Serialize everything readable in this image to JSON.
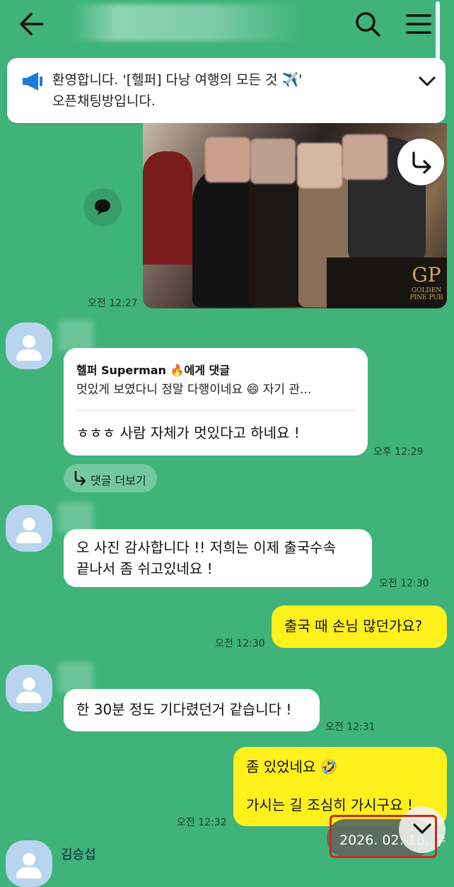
{
  "header": {
    "icons": [
      "back-arrow-icon",
      "search-icon",
      "menu-icon"
    ]
  },
  "notice": {
    "text": "환영합니다. '[헬퍼] 다낭 여행의 모든 것 ✈️'\n오픈채팅방입니다.",
    "icon": "megaphone-icon"
  },
  "photo": {
    "time": "오전 12:27",
    "logo_mark": "GP",
    "logo_text": "GOLDEN PINE PUB"
  },
  "reply_card": {
    "header": "헬퍼 Superman 🔥에게 댓글",
    "quote": "멋있게 보였다니 정말 다행이네요 😄  자기 관...",
    "text": "ㅎㅎㅎ 사람 자체가 멋있다고 하네요 !",
    "time": "오후 12:29"
  },
  "more_comments": {
    "label": "댓글 더보기"
  },
  "messages": [
    {
      "side": "left",
      "lines": [
        "오 사진 감사합니다 !! 저희는 이제 출국수속",
        "끝나서 좀 쉬고있네요 !"
      ],
      "time": "오전 12:30"
    },
    {
      "side": "right",
      "lines": [
        "출국 때 손님 많던가요?"
      ],
      "time": "오전 12:30"
    },
    {
      "side": "left",
      "lines": [
        "한 30분 정도 기다렸던거 같습니다 !"
      ],
      "time": "오전 12:31"
    },
    {
      "side": "right",
      "lines": [
        "좀 있었네요 🤣",
        "가시는 길 조심히 가시구요 !"
      ],
      "time": "오전 12:32"
    }
  ],
  "date_indicator": {
    "text": "2026. 02. 18. 수"
  },
  "bottom_sender": {
    "name": "김승섭"
  },
  "colors": {
    "background": "#3fb37a",
    "my_bubble": "#fef01b",
    "highlight": "#d32424"
  }
}
